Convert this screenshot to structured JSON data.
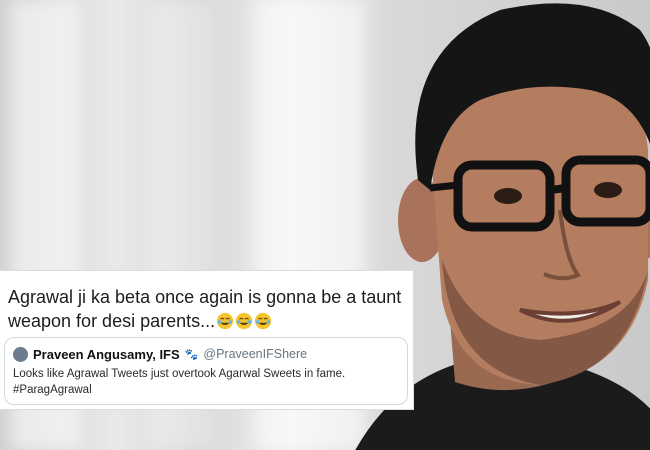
{
  "tweet": {
    "text": "Agrawal ji ka beta once again is gonna be a taunt weapon for desi parents...",
    "emoji_names": [
      "face-with-tears-of-joy-icon",
      "face-with-tears-of-joy-icon",
      "face-with-tears-of-joy-icon"
    ]
  },
  "quoted_tweet": {
    "display_name": "Praveen Angusamy, IFS",
    "badge": "🐾",
    "handle": "@PraveenIFShere",
    "line1": "Looks like Agrawal Tweets just overtook Agarwal Sweets in fame.",
    "line2": "#ParagAgrawal"
  },
  "colors": {
    "card_bg": "#ffffff",
    "handle_grey": "#66757f",
    "shirt": "#1a1a1a"
  }
}
